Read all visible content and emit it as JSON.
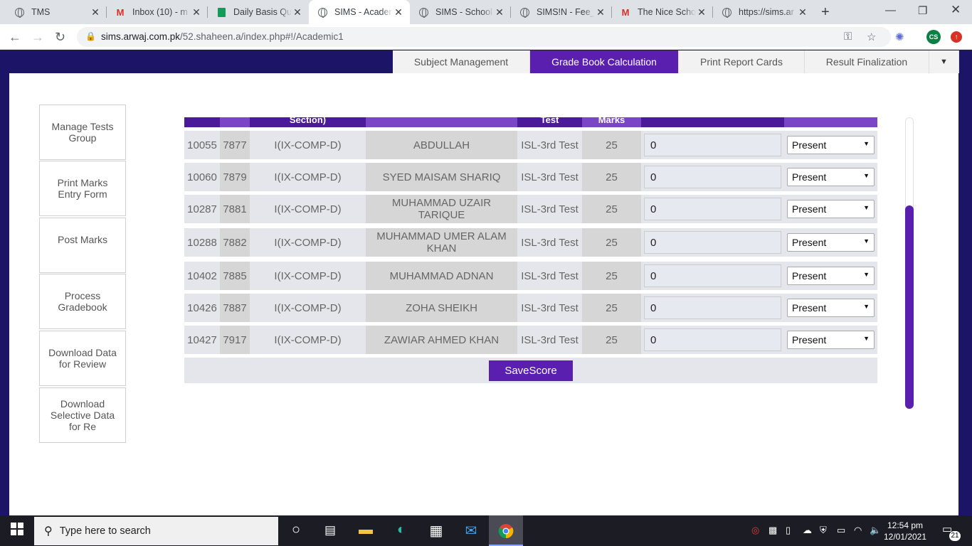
{
  "browser": {
    "tabs": [
      {
        "title": "TMS",
        "icon": "globe-icon"
      },
      {
        "title": "Inbox (10) - m",
        "icon": "gmail-icon"
      },
      {
        "title": "Daily Basis Qu",
        "icon": "sheets-icon"
      },
      {
        "title": "SIMS - Academ",
        "icon": "globe-icon",
        "active": true
      },
      {
        "title": "SIMS - School",
        "icon": "globe-icon"
      },
      {
        "title": "SIMS!N - Fee_I",
        "icon": "globe-icon"
      },
      {
        "title": "The Nice Scho",
        "icon": "gmail-icon"
      },
      {
        "title": "https://sims.ar",
        "icon": "globe-icon"
      }
    ],
    "url_host": "sims.arwaj.com.pk",
    "url_path": "/52.shaheen.a/index.php#!/Academic1",
    "profile_initials": "CS"
  },
  "subtabs": [
    "Subject Management",
    "Grade Book Calculation",
    "Print Report Cards",
    "Result Finalization"
  ],
  "active_subtab": "Grade Book Calculation",
  "side_menu": [
    "Manage Tests Group",
    "Print Marks Entry Form",
    "Post Marks",
    "Process Gradebook",
    "Download Data for Review",
    "Download Selective Data for Re"
  ],
  "table_header": {
    "section": "Section)",
    "test": "Test",
    "marks": "Marks"
  },
  "rows": [
    {
      "id": "10055",
      "roll": "7877",
      "section": "I(IX-COMP-D)",
      "name": "ABDULLAH",
      "test": "ISL-3rd Test",
      "total": "25",
      "obtained": "0",
      "attendance": "Present"
    },
    {
      "id": "10060",
      "roll": "7879",
      "section": "I(IX-COMP-D)",
      "name": "SYED MAISAM SHARIQ",
      "test": "ISL-3rd Test",
      "total": "25",
      "obtained": "0",
      "attendance": "Present"
    },
    {
      "id": "10287",
      "roll": "7881",
      "section": "I(IX-COMP-D)",
      "name": "MUHAMMAD UZAIR TARIQUE",
      "test": "ISL-3rd Test",
      "total": "25",
      "obtained": "0",
      "attendance": "Present"
    },
    {
      "id": "10288",
      "roll": "7882",
      "section": "I(IX-COMP-D)",
      "name": "MUHAMMAD UMER ALAM KHAN",
      "test": "ISL-3rd Test",
      "total": "25",
      "obtained": "0",
      "attendance": "Present"
    },
    {
      "id": "10402",
      "roll": "7885",
      "section": "I(IX-COMP-D)",
      "name": "MUHAMMAD ADNAN",
      "test": "ISL-3rd Test",
      "total": "25",
      "obtained": "0",
      "attendance": "Present"
    },
    {
      "id": "10426",
      "roll": "7887",
      "section": "I(IX-COMP-D)",
      "name": "ZOHA SHEIKH",
      "test": "ISL-3rd Test",
      "total": "25",
      "obtained": "0",
      "attendance": "Present"
    },
    {
      "id": "10427",
      "roll": "7917",
      "section": "I(IX-COMP-D)",
      "name": "ZAWIAR AHMED KHAN",
      "test": "ISL-3rd Test",
      "total": "25",
      "obtained": "0",
      "attendance": "Present"
    }
  ],
  "save_label": "SaveScore",
  "taskbar": {
    "search_placeholder": "Type here to search",
    "time": "12:54 pm",
    "date": "12/01/2021",
    "notifications": "21"
  },
  "colors": {
    "accent": "#5a1fae",
    "header_dark": "#4a1a9a",
    "header_light": "#7b45c8",
    "frame": "#1c1466"
  }
}
